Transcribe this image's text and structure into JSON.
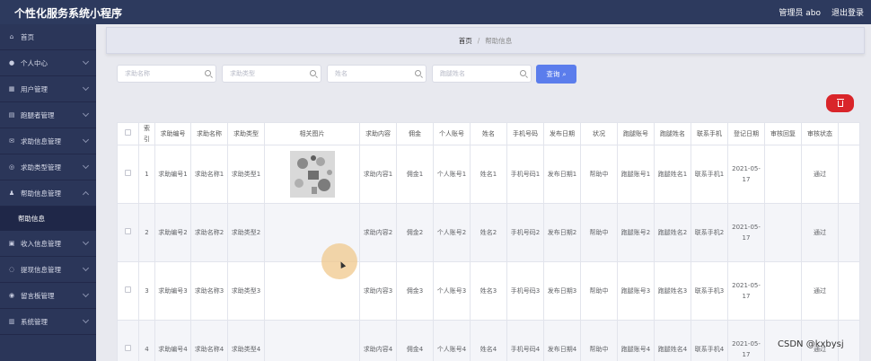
{
  "app": {
    "title": "个性化服务系统小程序"
  },
  "header": {
    "admin_label": "管理员 abo",
    "logout": "退出登录"
  },
  "sidebar": {
    "items": [
      {
        "label": "首页",
        "icon": "home-icon",
        "glyph": "⌂",
        "chevron": false
      },
      {
        "label": "个人中心",
        "icon": "user-icon",
        "glyph": "●",
        "chevron": true
      },
      {
        "label": "用户管理",
        "icon": "table-icon",
        "glyph": "▦",
        "chevron": true
      },
      {
        "label": "跑腿者管理",
        "icon": "grid-icon",
        "glyph": "▤",
        "chevron": true
      },
      {
        "label": "求助信息管理",
        "icon": "mail-icon",
        "glyph": "✉",
        "chevron": true
      },
      {
        "label": "求助类型管理",
        "icon": "compass-icon",
        "glyph": "◎",
        "chevron": true
      },
      {
        "label": "帮助信息管理",
        "icon": "person-icon",
        "glyph": "♟",
        "chevron": true,
        "expanded": true
      }
    ],
    "submenu": {
      "label": "帮助信息"
    },
    "items_after": [
      {
        "label": "收入信息管理",
        "icon": "wallet-icon",
        "glyph": "▣",
        "chevron": true
      },
      {
        "label": "提现信息管理",
        "icon": "bulb-icon",
        "glyph": "◌",
        "chevron": true
      },
      {
        "label": "留言板管理",
        "icon": "chat-icon",
        "glyph": "◉",
        "chevron": true
      },
      {
        "label": "系统管理",
        "icon": "bars-icon",
        "glyph": "▥",
        "chevron": true
      }
    ]
  },
  "breadcrumb": {
    "home": "首页",
    "separator": "/",
    "current": "帮助信息"
  },
  "search": {
    "fields": [
      {
        "placeholder": "求助名称"
      },
      {
        "placeholder": "求助类型"
      },
      {
        "placeholder": "姓名"
      },
      {
        "placeholder": "跑腿姓名"
      }
    ],
    "button_label": "查询"
  },
  "table": {
    "headers": [
      "",
      "索引",
      "求助编号",
      "求助名称",
      "求助类型",
      "相关图片",
      "求助内容",
      "佣金",
      "个人账号",
      "姓名",
      "手机号码",
      "发布日期",
      "状况",
      "跑腿账号",
      "跑腿姓名",
      "联系手机",
      "登记日期",
      "审核回复",
      "审核状态",
      ""
    ],
    "rows": [
      [
        "",
        "1",
        "求助编号1",
        "求助名称1",
        "求助类型1",
        "",
        "求助内容1",
        "佣金1",
        "个人账号1",
        "姓名1",
        "手机号码1",
        "发布日期1",
        "帮助中",
        "跑腿账号1",
        "跑腿姓名1",
        "联系手机1",
        "2021-05-17",
        "",
        "通过",
        ""
      ],
      [
        "",
        "2",
        "求助编号2",
        "求助名称2",
        "求助类型2",
        "",
        "求助内容2",
        "佣金2",
        "个人账号2",
        "姓名2",
        "手机号码2",
        "发布日期2",
        "帮助中",
        "跑腿账号2",
        "跑腿姓名2",
        "联系手机2",
        "2021-05-17",
        "",
        "通过",
        ""
      ],
      [
        "",
        "3",
        "求助编号3",
        "求助名称3",
        "求助类型3",
        "",
        "求助内容3",
        "佣金3",
        "个人账号3",
        "姓名3",
        "手机号码3",
        "发布日期3",
        "帮助中",
        "跑腿账号3",
        "跑腿姓名3",
        "联系手机3",
        "2021-05-17",
        "",
        "通过",
        ""
      ],
      [
        "",
        "4",
        "求助编号4",
        "求助名称4",
        "求助类型4",
        "",
        "求助内容4",
        "佣金4",
        "个人账号4",
        "姓名4",
        "手机号码4",
        "发布日期4",
        "帮助中",
        "跑腿账号4",
        "跑腿姓名4",
        "联系手机4",
        "2021-05-17",
        "",
        "通过",
        ""
      ]
    ]
  },
  "watermark": "CSDN @kxbysj",
  "colors": {
    "topbar": "#2d3a5e",
    "sidebar": "#2b3659",
    "search_button": "#5b7dec",
    "delete_button": "#d9252a"
  }
}
